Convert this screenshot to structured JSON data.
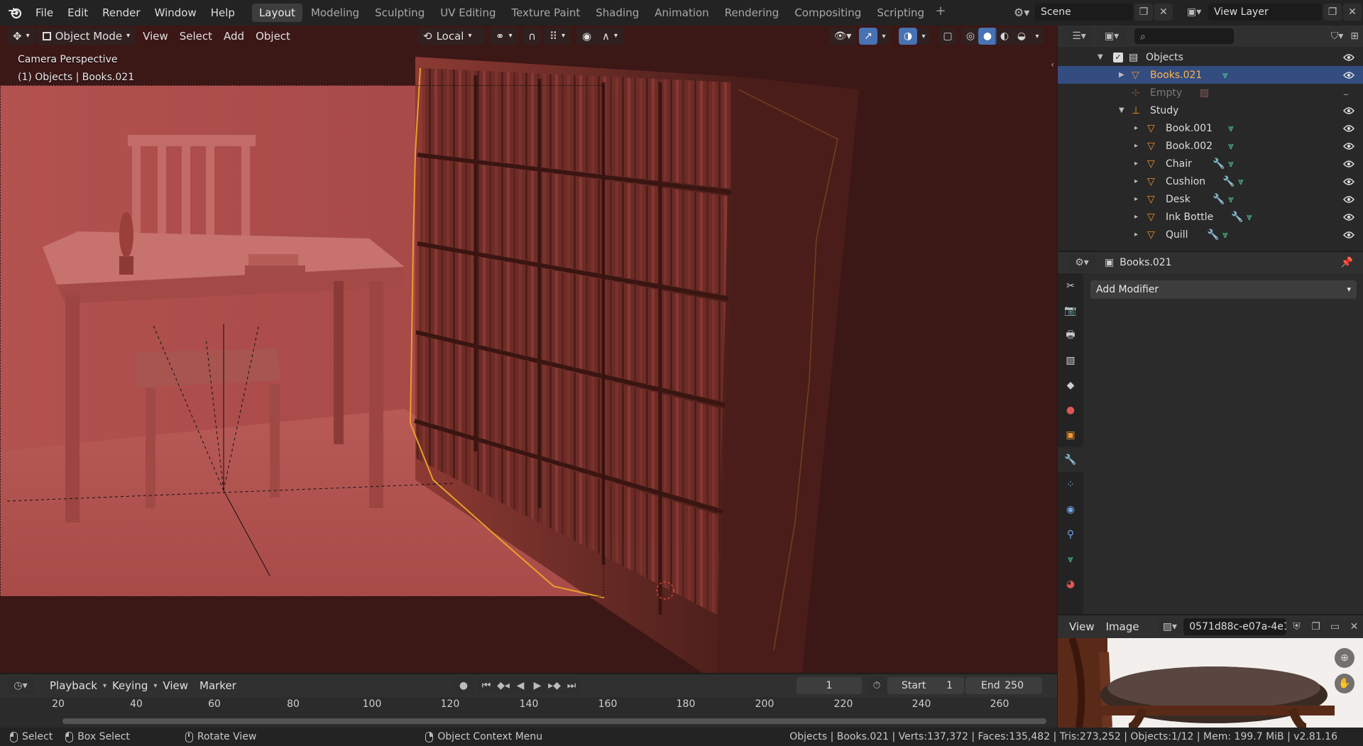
{
  "menu": {
    "items": [
      "File",
      "Edit",
      "Render",
      "Window",
      "Help"
    ]
  },
  "workspaces": {
    "tabs": [
      "Layout",
      "Modeling",
      "Sculpting",
      "UV Editing",
      "Texture Paint",
      "Shading",
      "Animation",
      "Rendering",
      "Compositing",
      "Scripting"
    ],
    "active": "Layout"
  },
  "scene": {
    "name": "Scene",
    "view_layer": "View Layer"
  },
  "viewport": {
    "mode": "Object Mode",
    "menus": [
      "View",
      "Select",
      "Add",
      "Object"
    ],
    "orientation": "Local",
    "overlay_line1": "Camera Perspective",
    "overlay_line2": "(1) Objects | Books.021"
  },
  "outliner": {
    "collection": "Objects",
    "rows": [
      {
        "label": "Books.021",
        "selected": true,
        "dim": false
      },
      {
        "label": "Empty",
        "selected": false,
        "dim": true
      },
      {
        "label": "Study",
        "selected": false,
        "dim": false
      },
      {
        "label": "Book.001",
        "selected": false,
        "dim": false
      },
      {
        "label": "Book.002",
        "selected": false,
        "dim": false
      },
      {
        "label": "Chair",
        "selected": false,
        "dim": false
      },
      {
        "label": "Cushion",
        "selected": false,
        "dim": false
      },
      {
        "label": "Desk",
        "selected": false,
        "dim": false
      },
      {
        "label": "Ink Bottle",
        "selected": false,
        "dim": false
      },
      {
        "label": "Quill",
        "selected": false,
        "dim": false
      }
    ]
  },
  "properties": {
    "object_name": "Books.021",
    "add_modifier": "Add Modifier"
  },
  "image_editor": {
    "menus": [
      "View",
      "Image"
    ],
    "image_name": "0571d88c-e07a-4e1.."
  },
  "timeline": {
    "menus": [
      "Playback",
      "Keying",
      "View",
      "Marker"
    ],
    "current_frame": "1",
    "start_label": "Start",
    "start_value": "1",
    "end_label": "End",
    "end_value": "250",
    "ticks": [
      "20",
      "40",
      "60",
      "80",
      "100",
      "120",
      "140",
      "160",
      "180",
      "200",
      "220",
      "240",
      "260"
    ]
  },
  "statusbar": {
    "select": "Select",
    "box_select": "Box Select",
    "rotate_view": "Rotate View",
    "context_menu": "Object Context Menu",
    "stats": "Objects | Books.021 | Verts:137,372 | Faces:135,482 | Tris:273,252 | Objects:1/12 | Mem: 199.7 MiB | v2.81.16"
  },
  "colors": {
    "accent_blue": "#4772b3",
    "selection_orange": "#ffb14a",
    "mesh_icon_orange": "#e8902a",
    "data_icon_green": "#4fcf9a",
    "modifier_icon_blue": "#6fa4e6"
  }
}
